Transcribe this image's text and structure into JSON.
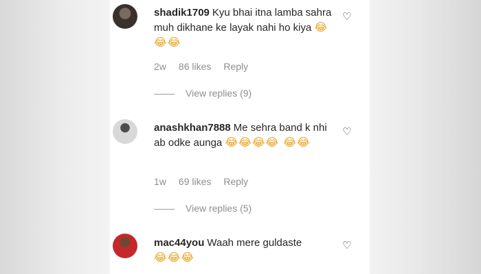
{
  "more_label": "...",
  "comments": [
    {
      "username": "shadik1709",
      "text": "Kyu bhai itna lamba sahra muh dikhane ke layak nahi ho kiya",
      "emojis": "😂😂😂",
      "age": "2w",
      "likes": "86 likes",
      "reply": "Reply",
      "view_replies": "View replies (9)"
    },
    {
      "username": "anashkhan7888",
      "text": "Me sehra band k nhi ab odke aunga",
      "emojis": "😂😂😂😂 😂😂",
      "age": "1w",
      "likes": "69 likes",
      "reply": "Reply",
      "view_replies": "View replies (5)"
    },
    {
      "username": "mac44you",
      "text": "Waah mere guldaste",
      "emojis": "😂😂😂"
    }
  ],
  "heart_icon": "♡"
}
